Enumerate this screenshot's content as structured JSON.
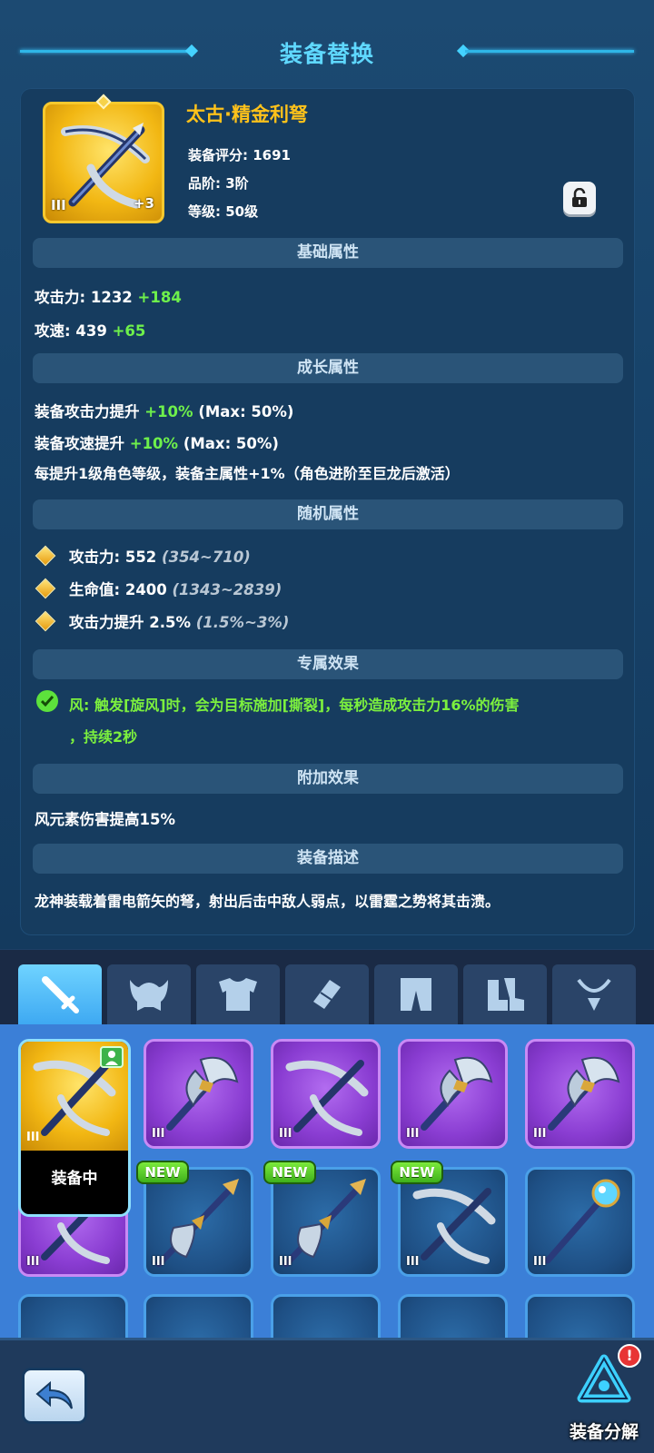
{
  "title": "装备替换",
  "item": {
    "name": "太古·精金利弩",
    "score": "装备评分: 1691",
    "grade": "品阶: 3阶",
    "level": "等级: 50级",
    "tier": "III",
    "plus": "+3"
  },
  "sections": {
    "base": "基础属性",
    "growth": "成长属性",
    "random": "随机属性",
    "exclusive": "专属效果",
    "extra": "附加效果",
    "desc": "装备描述"
  },
  "base_stats": [
    {
      "label": "攻击力:",
      "value": "1232",
      "bonus": "+184"
    },
    {
      "label": "攻速:",
      "value": "439",
      "bonus": "+65"
    }
  ],
  "growth_stats": [
    {
      "label": "装备攻击力提升",
      "bonus": "+10%",
      "max": "(Max: 50%)"
    },
    {
      "label": "装备攻速提升",
      "bonus": "+10%",
      "max": "(Max: 50%)"
    },
    {
      "text": "每提升1级角色等级，装备主属性+1%（角色进阶至巨龙后激活）"
    }
  ],
  "random_stats": [
    {
      "label": "攻击力: 552",
      "range": "(354~710)"
    },
    {
      "label": "生命值: 2400",
      "range": "(1343~2839)"
    },
    {
      "label": "攻击力提升 2.5%",
      "range": "(1.5%~3%)"
    }
  ],
  "exclusive_effect": {
    "line1": "风: 触发[旋风]时，会为目标施加[撕裂]，每秒造成攻击力16%的伤害",
    "line2": "，持续2秒"
  },
  "extra_effect": "风元素伤害提高15%",
  "description": "龙神装载着雷电箭矢的弩，射出后击中敌人弱点，以雷霆之势将其击溃。",
  "tabs": [
    "sword-icon",
    "helmet-icon",
    "armor-icon",
    "bracer-icon",
    "pants-icon",
    "boots-icon",
    "necklace-icon"
  ],
  "grid": {
    "equipped_label": "装备中",
    "new_label": "NEW",
    "tier": "III"
  },
  "bottom": {
    "decompose_label": "装备分解",
    "alert": "!"
  }
}
